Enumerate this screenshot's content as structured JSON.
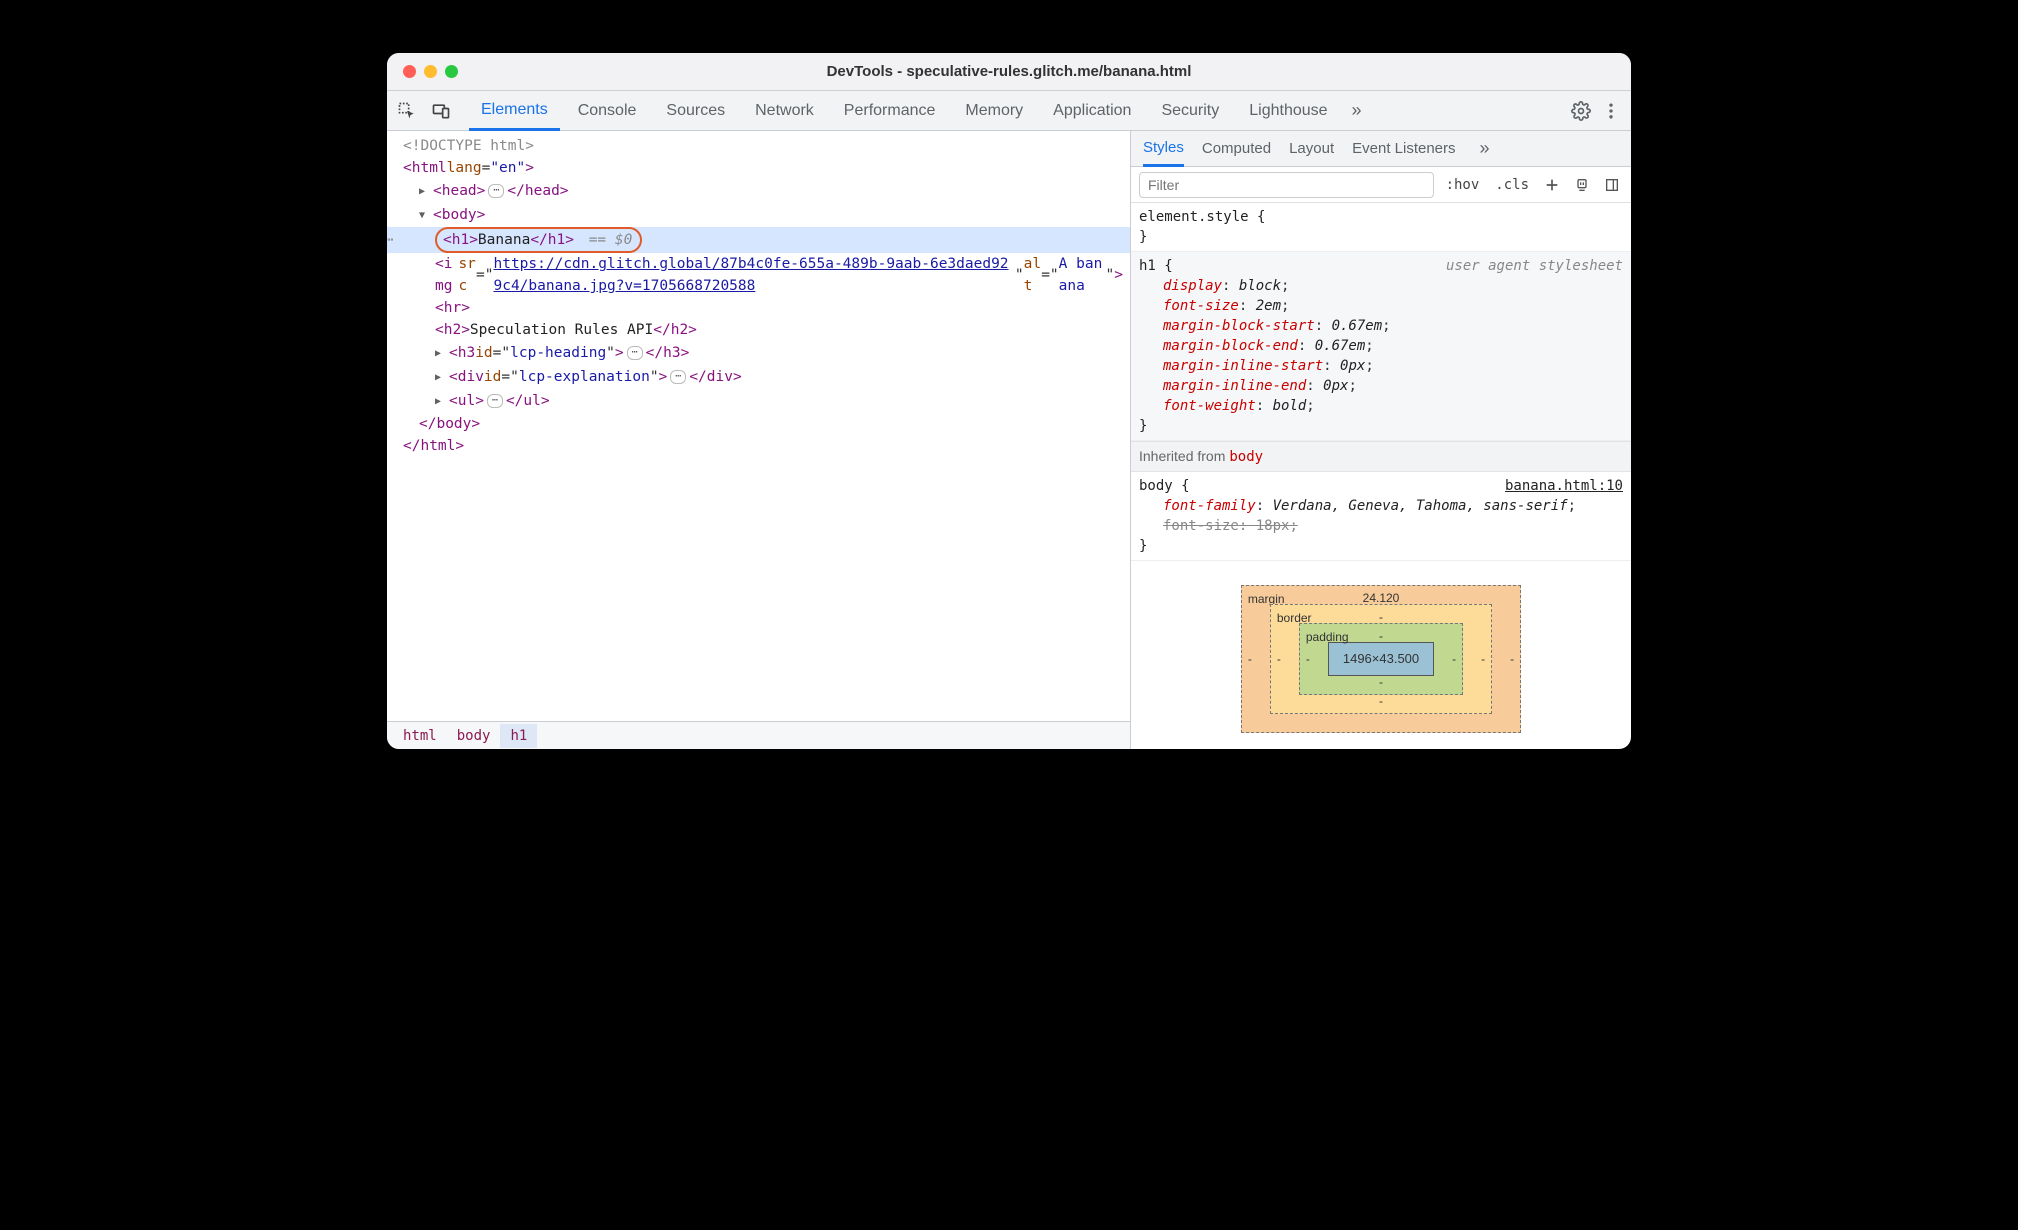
{
  "window": {
    "title": "DevTools - speculative-rules.glitch.me/banana.html"
  },
  "mainTabs": {
    "items": [
      "Elements",
      "Console",
      "Sources",
      "Network",
      "Performance",
      "Memory",
      "Application",
      "Security",
      "Lighthouse"
    ],
    "activeIndex": 0,
    "overflow_glyph": "»"
  },
  "dom": {
    "doctype": "<!DOCTYPE html>",
    "html_open": "<html lang=\"en\">",
    "head_open": "<head>",
    "head_close": "</head>",
    "body_open": "<body>",
    "selected_h1_open": "<h1>",
    "selected_h1_text": "Banana",
    "selected_h1_close": "</h1>",
    "selected_marker": "== $0",
    "img_prefix": "<img src=\"",
    "img_url": "https://cdn.glitch.global/87b4c0fe-655a-489b-9aab-6e3daed929c4/banana.jpg?v=1705668720588",
    "img_suffix_alt": "\" alt=\"",
    "img_alt": "A banana",
    "img_close": "\">",
    "hr": "<hr>",
    "h2_open": "<h2>",
    "h2_text": "Speculation Rules API",
    "h2_close": "</h2>",
    "h3_open": "<h3 id=\"",
    "h3_id": "lcp-heading",
    "h3_mid": "\">",
    "h3_close": "</h3>",
    "div_open": "<div id=\"",
    "div_id": "lcp-explanation",
    "div_mid": "\">",
    "div_close": "</div>",
    "ul_open": "<ul>",
    "ul_close": "</ul>",
    "body_close": "</body>",
    "html_close": "</html>"
  },
  "breadcrumb": [
    "html",
    "body",
    "h1"
  ],
  "stylesTabs": {
    "items": [
      "Styles",
      "Computed",
      "Layout",
      "Event Listeners"
    ],
    "activeIndex": 0,
    "overflow_glyph": "»"
  },
  "stylesToolbar": {
    "filter_placeholder": "Filter",
    "hov": ":hov",
    "cls": ".cls"
  },
  "rules": {
    "elementStyle": {
      "selector": "element.style",
      "decls": []
    },
    "h1": {
      "selector": "h1",
      "source": "user agent stylesheet",
      "decls": [
        {
          "prop": "display",
          "val": "block"
        },
        {
          "prop": "font-size",
          "val": "2em"
        },
        {
          "prop": "margin-block-start",
          "val": "0.67em"
        },
        {
          "prop": "margin-block-end",
          "val": "0.67em"
        },
        {
          "prop": "margin-inline-start",
          "val": "0px"
        },
        {
          "prop": "margin-inline-end",
          "val": "0px"
        },
        {
          "prop": "font-weight",
          "val": "bold"
        }
      ]
    },
    "inheritedFrom": "Inherited from",
    "inheritedEl": "body",
    "body": {
      "selector": "body",
      "source": "banana.html:10",
      "decls": [
        {
          "prop": "font-family",
          "val": "Verdana, Geneva, Tahoma, sans-serif",
          "strike": false
        },
        {
          "prop": "font-size",
          "val": "18px",
          "strike": true
        }
      ]
    }
  },
  "boxModel": {
    "margin": {
      "label": "margin",
      "top": "24.120",
      "right": "-",
      "bottom": "-",
      "left": "-"
    },
    "border": {
      "label": "border",
      "top": "-",
      "right": "-",
      "bottom": "-",
      "left": "-"
    },
    "padding": {
      "label": "padding",
      "top": "-",
      "right": "-",
      "bottom": "-",
      "left": "-"
    },
    "content": "1496×43.500"
  }
}
